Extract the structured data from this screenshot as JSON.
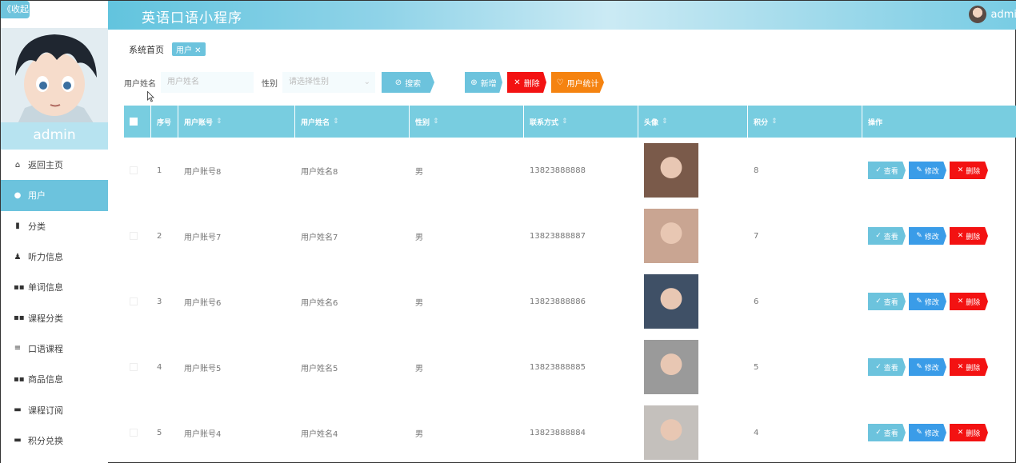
{
  "app": {
    "title": "英语口语小程序",
    "user_name": "admi",
    "collapse_label": "《收起"
  },
  "sidebar": {
    "admin_label": "admin",
    "items": [
      {
        "label": "返回主页",
        "icon": "home-icon",
        "glyph": "⌂",
        "active": false
      },
      {
        "label": "用户",
        "icon": "user-pin-icon",
        "glyph": "●",
        "active": true
      },
      {
        "label": "分类",
        "icon": "clipboard-icon",
        "glyph": "▮",
        "active": false
      },
      {
        "label": "听力信息",
        "icon": "person-icon",
        "glyph": "♟",
        "active": false
      },
      {
        "label": "单词信息",
        "icon": "grid-icon",
        "glyph": "▪▪",
        "active": false
      },
      {
        "label": "课程分类",
        "icon": "grid-icon",
        "glyph": "▪▪",
        "active": false
      },
      {
        "label": "口语课程",
        "icon": "list-icon",
        "glyph": "≡",
        "active": false
      },
      {
        "label": "商品信息",
        "icon": "grid-icon",
        "glyph": "▪▪",
        "active": false
      },
      {
        "label": "课程订阅",
        "icon": "monitor-icon",
        "glyph": "▬",
        "active": false
      },
      {
        "label": "积分兑换",
        "icon": "chat-icon",
        "glyph": "▬",
        "active": false
      }
    ]
  },
  "breadcrumb": {
    "home": "系统首页",
    "current": "用户 ✕"
  },
  "search": {
    "name_label": "用户姓名",
    "name_placeholder": "用户姓名",
    "gender_label": "性别",
    "gender_placeholder": "请选择性别",
    "search_btn": "搜索",
    "add_btn": "新增",
    "delete_btn": "删除",
    "stat_btn": "用户统计"
  },
  "table": {
    "headers": [
      "",
      "序号",
      "用户账号",
      "用户姓名",
      "性别",
      "联系方式",
      "头像",
      "积分",
      "操作"
    ],
    "sort_glyph": "⇕",
    "actions": {
      "view": "查看",
      "edit": "修改",
      "delete": "删除"
    },
    "rows": [
      {
        "index": "1",
        "account": "用户账号8",
        "name": "用户姓名8",
        "gender": "男",
        "phone": "13823888888",
        "points": "8",
        "avatar_color": "#7a5a4a"
      },
      {
        "index": "2",
        "account": "用户账号7",
        "name": "用户姓名7",
        "gender": "男",
        "phone": "13823888887",
        "points": "7",
        "avatar_color": "#c9a592"
      },
      {
        "index": "3",
        "account": "用户账号6",
        "name": "用户姓名6",
        "gender": "男",
        "phone": "13823888886",
        "points": "6",
        "avatar_color": "#3f5066"
      },
      {
        "index": "4",
        "account": "用户账号5",
        "name": "用户姓名5",
        "gender": "男",
        "phone": "13823888885",
        "points": "5",
        "avatar_color": "#9a9a9a"
      },
      {
        "index": "5",
        "account": "用户账号4",
        "name": "用户姓名4",
        "gender": "男",
        "phone": "13823888884",
        "points": "4",
        "avatar_color": "#c4c0bc"
      }
    ]
  },
  "colors": {
    "accent": "#6cc3dd",
    "danger": "#f31212",
    "warning": "#f58310",
    "edit": "#3a9ce8"
  }
}
